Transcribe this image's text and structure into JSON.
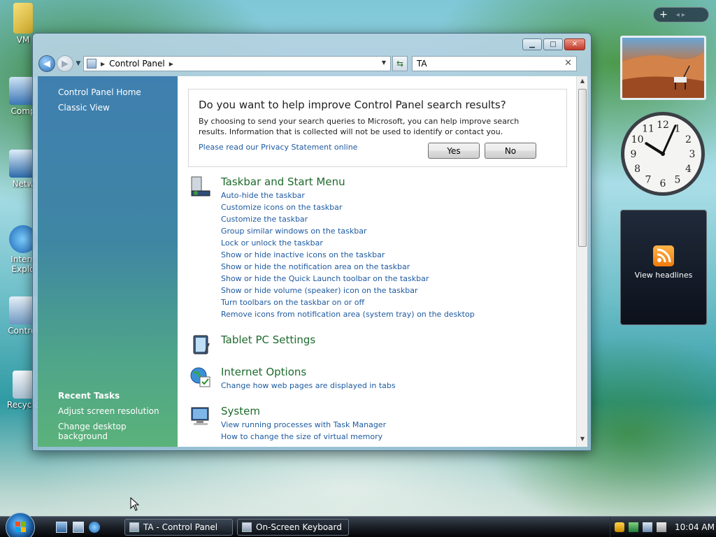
{
  "desktop": {
    "icons": [
      {
        "name": "vm-folder",
        "label": "VM"
      },
      {
        "name": "computer",
        "label": "Comp"
      },
      {
        "name": "network",
        "label": "Netw"
      },
      {
        "name": "internet-explorer",
        "label": "Intern Explo"
      },
      {
        "name": "control-panel",
        "label": "Control"
      },
      {
        "name": "recycle-bin",
        "label": "Recycle"
      }
    ]
  },
  "sidebar": {
    "add_label": "+",
    "nav_label": "◂ ▸",
    "feed_label": "View headlines",
    "clock": {
      "hour": 10,
      "minute": 4
    }
  },
  "window": {
    "title_controls": {
      "minimize": "▁",
      "maximize": "□",
      "close": "✕"
    },
    "address": {
      "crumb": "Control Panel"
    },
    "search": {
      "value": "TA"
    },
    "left_pane": {
      "home": "Control Panel Home",
      "classic": "Classic View",
      "recent_header": "Recent Tasks",
      "recent": [
        "Adjust screen resolution",
        "Change desktop background"
      ]
    },
    "infobox": {
      "question": "Do you want to help improve Control Panel search results?",
      "body": "By choosing to send your search queries to Microsoft, you can help improve search results. Information that is collected will not be used to identify or contact you.",
      "privacy": "Please read our Privacy Statement online",
      "yes": "Yes",
      "no": "No"
    },
    "groups": [
      {
        "title": "Taskbar and Start Menu",
        "icon": "taskbar-icon",
        "links": [
          "Auto-hide the taskbar",
          "Customize icons on the taskbar",
          "Customize the taskbar",
          "Group similar windows on the taskbar",
          "Lock or unlock the taskbar",
          "Show or hide inactive icons on the taskbar",
          "Show or hide the notification area on the taskbar",
          "Show or hide the Quick Launch toolbar on the taskbar",
          "Show or hide volume (speaker) icon on the taskbar",
          "Turn toolbars on the taskbar on or off",
          "Remove icons from notification area (system tray) on the desktop"
        ]
      },
      {
        "title": "Tablet PC Settings",
        "icon": "tablet-icon",
        "links": []
      },
      {
        "title": "Internet Options",
        "icon": "internet-options-icon",
        "links": [
          "Change how web pages are displayed in tabs"
        ]
      },
      {
        "title": "System",
        "icon": "system-icon",
        "links": [
          "View running processes with Task Manager",
          "How to change the size of virtual memory"
        ]
      }
    ]
  },
  "taskbar": {
    "tasks": [
      {
        "label": "TA - Control Panel",
        "active": true
      },
      {
        "label": "On-Screen Keyboard",
        "active": false
      }
    ],
    "time": "10:04 AM"
  },
  "colors": {
    "link": "#1e5aa0",
    "group_title": "#1e6b2c"
  }
}
